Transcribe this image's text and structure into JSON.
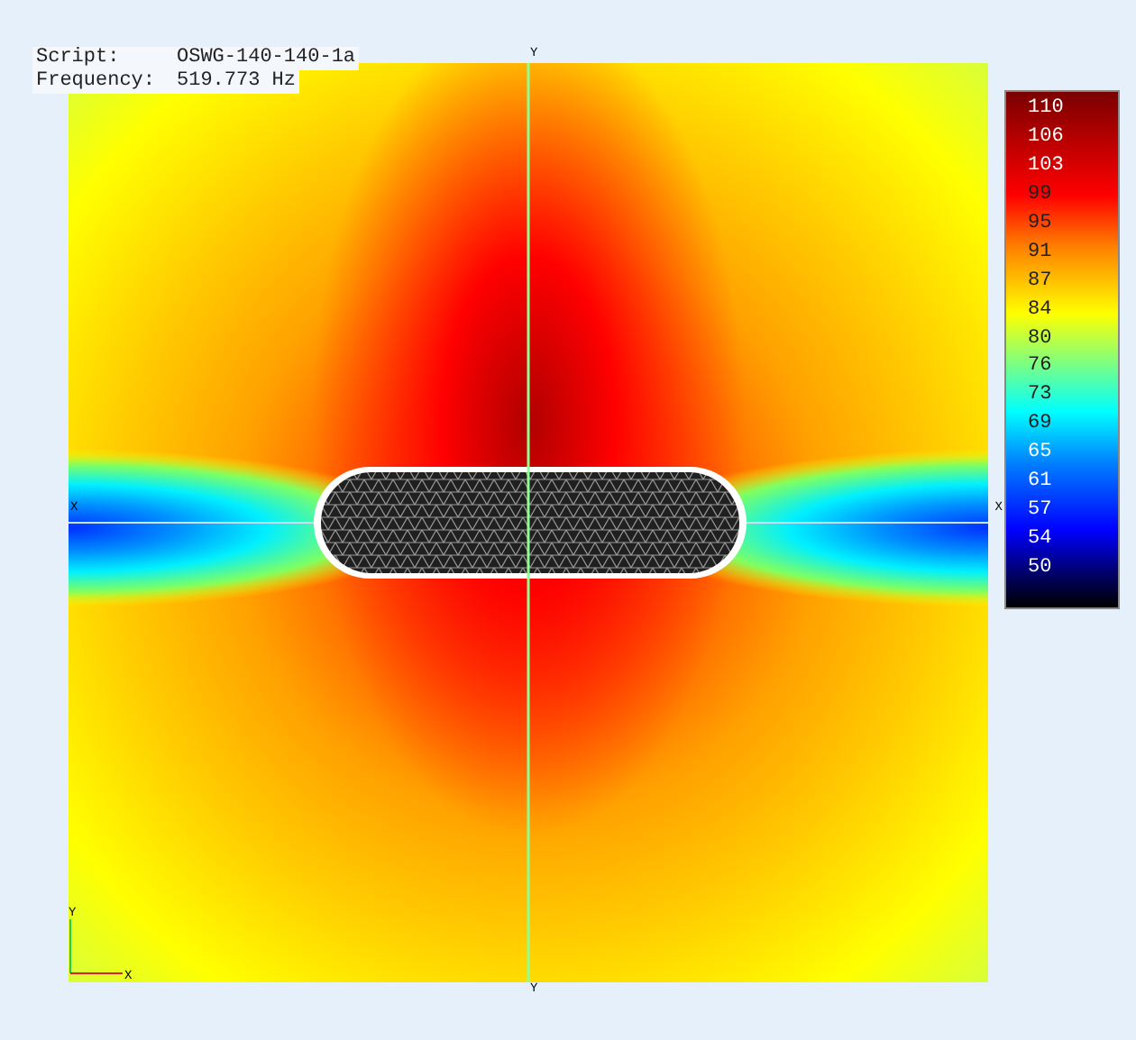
{
  "info": [
    {
      "label": "Script:",
      "value": "OSWG-140-140-1a"
    },
    {
      "label": "Frequency:",
      "value": "519.773 Hz"
    }
  ],
  "plot": {
    "axis_marks": {
      "top": "Y",
      "right": "X",
      "bottom": "Y",
      "left": "X"
    },
    "triad": {
      "x": "X",
      "y": "Y"
    }
  },
  "colorbar": {
    "ticks": [
      "110",
      "106",
      "103",
      "99",
      "95",
      "91",
      "87",
      "84",
      "80",
      "76",
      "73",
      "69",
      "65",
      "61",
      "57",
      "54",
      "50"
    ]
  }
}
